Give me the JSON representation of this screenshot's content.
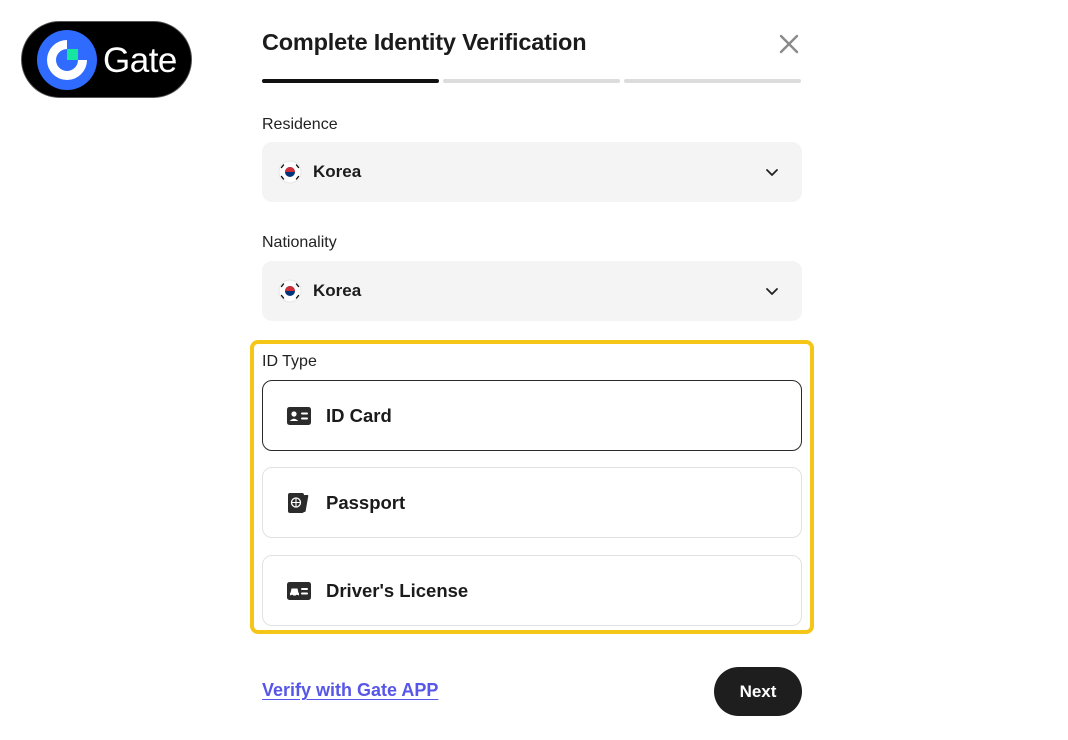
{
  "logo": {
    "text": "Gate"
  },
  "header": {
    "title": "Complete Identity Verification",
    "close_icon": "close-icon"
  },
  "progress": {
    "steps_total": 3,
    "current_step": 1
  },
  "residence": {
    "label": "Residence",
    "value": "Korea",
    "flag_icon": "korea-flag-icon"
  },
  "nationality": {
    "label": "Nationality",
    "value": "Korea",
    "flag_icon": "korea-flag-icon"
  },
  "id_type": {
    "label": "ID Type",
    "selected": "ID Card",
    "options": [
      {
        "label": "ID Card",
        "icon": "id-card-icon"
      },
      {
        "label": "Passport",
        "icon": "passport-icon"
      },
      {
        "label": "Driver's License",
        "icon": "drivers-license-icon"
      }
    ]
  },
  "footer": {
    "verify_link": "Verify with Gate APP",
    "next_label": "Next"
  },
  "colors": {
    "highlight": "#f5c518",
    "link": "#5656e8",
    "button_bg": "#1e1e1e",
    "field_bg": "#f4f4f5",
    "progress_active": "#111111",
    "progress_inactive": "#dcdcdc",
    "logo_blue": "#2f6bff",
    "logo_green": "#17e6a1"
  }
}
